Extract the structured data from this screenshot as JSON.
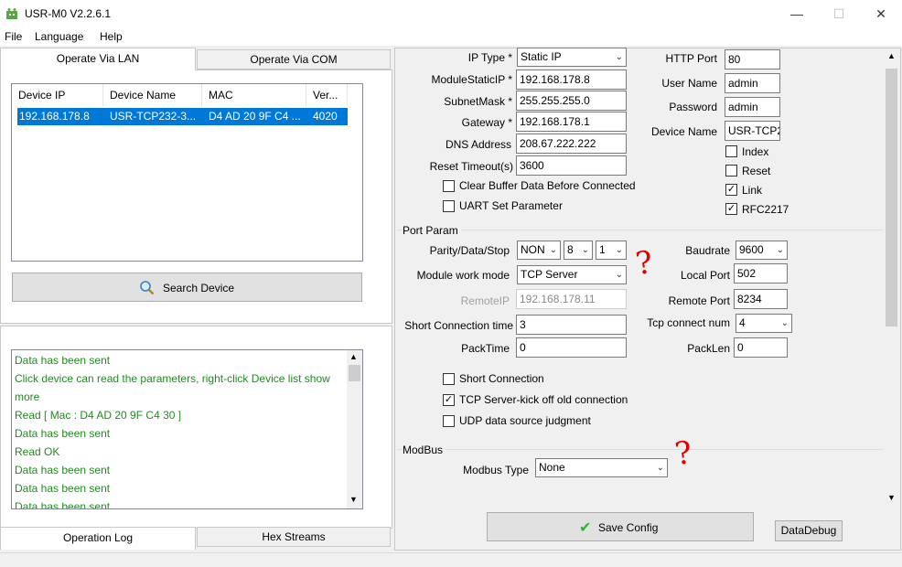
{
  "window": {
    "title": "USR-M0 V2.2.6.1",
    "minimize": "—",
    "maximize": "☐",
    "close": "✕"
  },
  "menu": [
    "File",
    "Language",
    "Help"
  ],
  "left": {
    "tabs": [
      "Operate Via LAN",
      "Operate Via COM"
    ],
    "columns": [
      "Device IP",
      "Device Name",
      "MAC",
      "Ver..."
    ],
    "rows": [
      {
        "ip": "192.168.178.8",
        "name": "USR-TCP232-3...",
        "mac": "D4 AD 20 9F C4 ...",
        "ver": "4020"
      }
    ],
    "search_button": "Search Device",
    "log_lines": [
      " Data has been sent",
      "Click device can read the parameters, right-click Device list show",
      "more",
      "Read [ Mac : D4 AD 20 9F C4 30 ]",
      " Data has been sent",
      "Read OK",
      " Data has been sent",
      " Data has been sent",
      " Data has been sent"
    ],
    "bottom_tabs": [
      "Operation Log",
      "Hex Streams"
    ]
  },
  "form": {
    "ip_type_label": "IP Type *",
    "ip_type": "Static IP",
    "static_ip_label": "ModuleStaticIP *",
    "static_ip": "192.168.178.8",
    "subnet_label": "SubnetMask *",
    "subnet": "255.255.255.0",
    "gateway_label": "Gateway *",
    "gateway": "192.168.178.1",
    "dns_label": "DNS Address",
    "dns": "208.67.222.222",
    "reset_timeout_label": "Reset Timeout(s)",
    "reset_timeout": "3600",
    "clear_buffer_label": "Clear Buffer Data Before Connected",
    "uart_set_label": "UART Set Parameter",
    "http_port_label": "HTTP Port",
    "http_port": "80",
    "username_label": "User Name",
    "username": "admin",
    "password_label": "Password",
    "password": "admin",
    "device_name_label": "Device Name",
    "device_name": "USR-TCP2",
    "index_label": "Index",
    "reset_label": "Reset",
    "link_label": "Link",
    "rfc2217_label": "RFC2217",
    "port_param_group": "Port Param",
    "parity_label": "Parity/Data/Stop",
    "parity": "NON",
    "data_bits": "8",
    "stop_bits": "1",
    "baudrate_label": "Baudrate",
    "baudrate": "9600",
    "work_mode_label": "Module work mode",
    "work_mode": "TCP Server",
    "local_port_label": "Local Port",
    "local_port": "502",
    "remote_ip_label": "RemoteIP",
    "remote_ip": "192.168.178.11",
    "remote_port_label": "Remote Port",
    "remote_port": "8234",
    "short_conn_time_label": "Short Connection time",
    "short_conn_time": "3",
    "tcp_connect_num_label": "Tcp connect num",
    "tcp_connect_num": "4",
    "packtime_label": "PackTime",
    "packtime": "0",
    "packlen_label": "PackLen",
    "packlen": "0",
    "short_connection_label": "Short Connection",
    "kick_off_label": "TCP Server-kick off old connection",
    "udp_judgment_label": "UDP data source judgment",
    "modbus_group": "ModBus",
    "modbus_type_label": "Modbus Type",
    "modbus_type": "None",
    "save_config": "Save Config",
    "data_debug": "DataDebug"
  },
  "annotations": [
    "?",
    "?"
  ],
  "colors": {
    "selection": "#0078d7",
    "log_text": "#228b22",
    "annotation": "#e00000",
    "save_check": "#2db52d"
  }
}
